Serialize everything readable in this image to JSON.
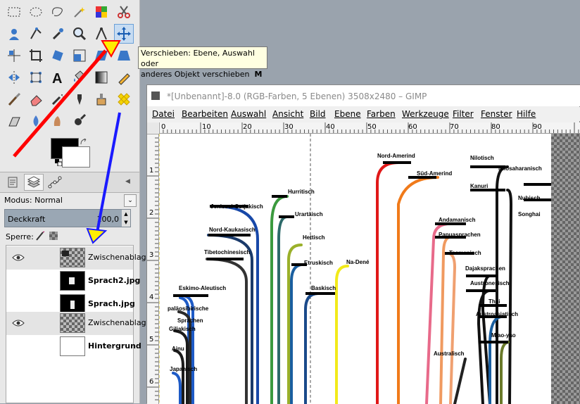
{
  "toolbox": {
    "tools": [
      "rect-select",
      "ellipse-select",
      "free-select",
      "fuzzy-select",
      "color-select",
      "scissors-select",
      "foreground-select",
      "paths",
      "color-picker",
      "zoom",
      "measure",
      "move",
      "align",
      "crop",
      "rotate",
      "scale",
      "shear",
      "perspective",
      "flip",
      "cage",
      "text",
      "bucket-fill",
      "blend",
      "pencil",
      "paintbrush",
      "eraser",
      "airbrush",
      "ink",
      "clone",
      "heal",
      "perspective-clone",
      "blur",
      "smudge",
      "dodge-burn"
    ],
    "active_tool": "move"
  },
  "tooltip": {
    "line1": "Verschieben: Ebene, Auswahl oder",
    "line2": "anderes Objekt verschieben",
    "shortcut": "M"
  },
  "layers_panel": {
    "mode_label": "Modus: Normal",
    "opacity_label": "Deckkraft",
    "opacity_value": "100,0",
    "lock_label": "Sperre:",
    "layers": [
      {
        "name": "Zwischenablage",
        "visible": true,
        "bold": false
      },
      {
        "name": "Sprach2.jpg",
        "visible": false,
        "bold": true
      },
      {
        "name": "Sprach.jpg",
        "visible": false,
        "bold": true
      },
      {
        "name": "Zwischenablage",
        "visible": true,
        "bold": false
      },
      {
        "name": "Hintergrund",
        "visible": false,
        "bold": true
      }
    ]
  },
  "image_window": {
    "title": "*[Unbenannt]-8.0 (RGB-Farben, 5 Ebenen) 3508x2480 – GIMP",
    "menus": [
      "Datei",
      "Bearbeiten",
      "Auswahl",
      "Ansicht",
      "Bild",
      "Ebene",
      "Farben",
      "Werkzeuge",
      "Filter",
      "Fenster",
      "Hilfe"
    ],
    "hruler": [
      "0",
      "10",
      "20",
      "30",
      "40",
      "50",
      "60",
      "70",
      "80",
      "90"
    ],
    "vruler": [
      "1",
      "2",
      "3",
      "4",
      "5",
      "6"
    ],
    "canvas_labels": [
      "Nord-Amerind",
      "Nilosaharanisch",
      "Nilotisch",
      "Süd-Amerind",
      "Kanuri",
      "Nubisch",
      "Songhai",
      "Hurritisch",
      "Jenissei-Ostjakisch",
      "Urartäisch",
      "Nord-Kaukasisch",
      "Hettisch",
      "Andamanisch",
      "Papuasprachen",
      "Tibetochinesisch",
      "Tasmanisch",
      "Na-Dené",
      "Etruskisch",
      "Dajaksprachen",
      "Baskisch",
      "Austronesisch",
      "Eskimo-Aleutisch",
      "Thai",
      "Austroasiatisch",
      "paläosibirische",
      "Sprachen",
      "Giljakisch",
      "Miao-yao",
      "Ainu",
      "Australisch",
      "Japanisch"
    ]
  },
  "annotations": {
    "red_arrow_color": "#ff0000",
    "yellow_arrow_color": "#ffee00",
    "blue_arrow_color": "#1a1aff"
  }
}
